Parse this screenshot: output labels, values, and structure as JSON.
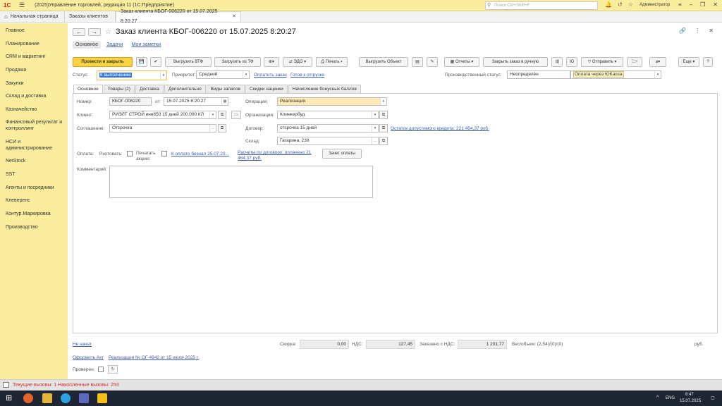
{
  "topbar": {
    "logo": "1С",
    "app_title": "(2025)Управление торговлей, редакция 11  (1С:Предприятие)",
    "search_placeholder": "Поиск Ctrl+Shift+F",
    "user": "Администратор"
  },
  "tabs": [
    {
      "label": "Начальная страница"
    },
    {
      "label": "Заказы клиентов"
    },
    {
      "label": "Заказ клиента КБОГ-006220 от 15.07.2025 8:20:27"
    }
  ],
  "sidebar": {
    "items": [
      {
        "label": "Главное"
      },
      {
        "label": "Планирование"
      },
      {
        "label": "CRM и маркетинг"
      },
      {
        "label": "Продажи"
      },
      {
        "label": "Закупки"
      },
      {
        "label": "Склад и доставка"
      },
      {
        "label": "Казначейство"
      },
      {
        "label": "Финансовый результат и контроллинг"
      },
      {
        "label": "НСИ и администрирование"
      },
      {
        "label": "NetStock"
      },
      {
        "label": "SST"
      },
      {
        "label": "Агенты и посредники"
      },
      {
        "label": "Клеверенс"
      },
      {
        "label": "Контур.Маркировка"
      },
      {
        "label": "Производство"
      }
    ]
  },
  "document": {
    "title": "Заказ клиента КБОГ-006220 от 15.07.2025 8:20:27",
    "subnav": [
      "Основное",
      "Задачи",
      "Мои заметки"
    ]
  },
  "toolbar": {
    "post_close": "Провести и закрыть",
    "export_vtf": "Выгрузить ВТФ",
    "import_tf": "Загрузить из ТФ",
    "edo": "ЭДО",
    "print": "Печать",
    "export_obj": "Выгрузить Объект",
    "reports": "Отчеты",
    "close_manual": "Закрыть заказ в ручную",
    "send": "Отправить",
    "more": "Еще",
    "help": "?"
  },
  "status_row": {
    "status_label": "Статус:",
    "status_value": "К выполнению",
    "priority_label": "Приоритет:",
    "priority_value": "Средний",
    "link_pay": "Оплатить заказ",
    "link_ready": "Готов к отгрузке",
    "prod_status_label": "Производственный статус:",
    "prod_status_value": "Неопределён",
    "prod_status_note": "Оплата через ЮKassa"
  },
  "form_tabs": [
    "Основное",
    "Товары (2)",
    "Доставка",
    "Дополнительно",
    "Виды запасов",
    "Скидки наценки",
    "Начисление бонусных баллов"
  ],
  "form": {
    "number_label": "Номер:",
    "number_value": "КБОГ-006220",
    "from_label": "от:",
    "date_value": "15.07.2025  8:20:27",
    "operation_label": "Операция:",
    "operation_value": "Реализация",
    "client_label": "Клиент:",
    "client_value": "РИЭЛТ СТРОЙ инн650 15 дней 200.000 КЛ",
    "org_label": "Организация:",
    "org_value": "Клинкербуд",
    "agreement_label": "Соглашение:",
    "agreement_value": "Отсрочка",
    "contract_label": "Договор:",
    "contract_value": "отсрочка 15 дней",
    "credit_link": "Остаток допустимого кредита: 221 464,37 руб.",
    "warehouse_label": "Склад:",
    "warehouse_value": "Гагарина, 239",
    "payment_label": "Оплата:",
    "cash_label": "Рнхтовать:",
    "print_label": "Печатать акцию:",
    "pay_link": "К оплате безнал 25.07.20...",
    "settlement_link": "Расчеты по договору: оплачено 21 464,37 руб.",
    "offset_btn": "Зачет оплаты",
    "comment_label": "Комментарий:"
  },
  "footer": {
    "not_started": "Не начат",
    "discount_label": "Скидка:",
    "discount_value": "0,00",
    "vat_label": "НДС:",
    "vat_value": "127,45",
    "total_label": "Заказано с НДС:",
    "total_value": "1 201,77",
    "weight_label": "Вес/объем: (2,54)/(0)/(0)",
    "currency": "руб.",
    "act_link": "Оформить Акт",
    "realization_link": "Реализация № ОГ-4642 от 15 июля 2025 г.",
    "checked_label": "Проверен:"
  },
  "statusbar": {
    "text": "Текущие вызовы: 1   Накопленные вызовы: 253"
  },
  "taskbar": {
    "lang": "ENG",
    "time": "8:47",
    "date": "15.07.2025"
  },
  "colors": {
    "accent_yellow": "#fbed9e",
    "primary_button": "#fbd23f",
    "link": "#3b5ea8",
    "status_text": "#d32f2f"
  }
}
